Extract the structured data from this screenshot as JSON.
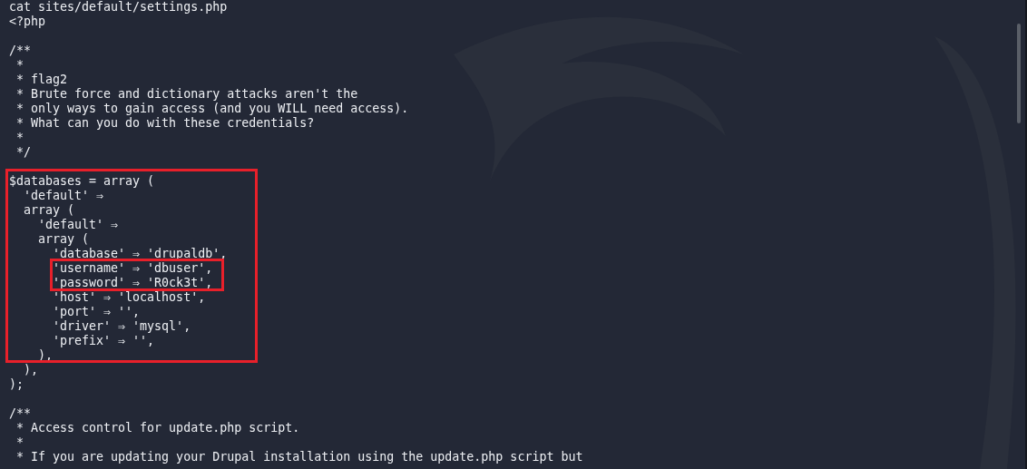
{
  "terminal": {
    "blocks": [
      [
        "cat sites/default/settings.php",
        "<?php"
      ],
      [
        "/**",
        " *",
        " * flag2",
        " * Brute force and dictionary attacks aren't the",
        " * only ways to gain access (and you WILL need access).",
        " * What can you do with these credentials?",
        " *",
        " */"
      ],
      [
        "$databases = array (",
        "  'default' ⇒",
        "  array (",
        "    'default' ⇒",
        "    array (",
        "      'database' ⇒ 'drupaldb',",
        "      'username' ⇒ 'dbuser',",
        "      'password' ⇒ 'R0ck3t',",
        "      'host' ⇒ 'localhost',",
        "      'port' ⇒ '',",
        "      'driver' ⇒ 'mysql',",
        "      'prefix' ⇒ '',",
        "    ),",
        "  ),",
        ");"
      ],
      [
        "/**",
        " * Access control for update.php script.",
        " *",
        " * If you are updating your Drupal installation using the update.php script but"
      ]
    ]
  }
}
